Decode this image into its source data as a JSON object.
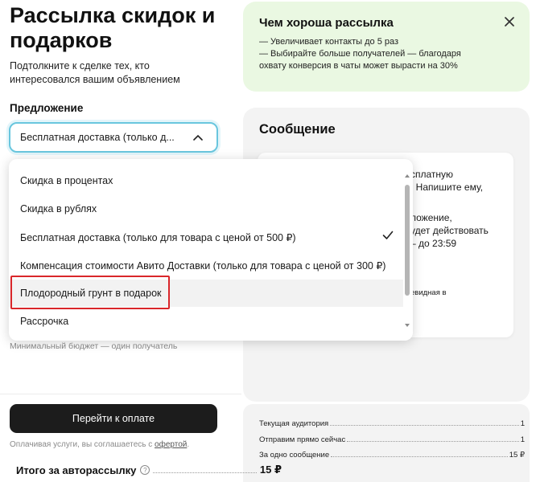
{
  "page": {
    "title": "Рассылка скидок и подарков",
    "subtitle": "Подтолкните к сделке тех, кто интересовался вашим объявлением"
  },
  "offer": {
    "label": "Предложение",
    "selected_value": "Бесплатная доставка (только д...",
    "options": [
      "Скидка в процентах",
      "Скидка в рублях",
      "Бесплатная доставка (только для товара с ценой от 500 ₽)",
      "Компенсация стоимости Авито Доставки (только для товара с ценой от 300 ₽)",
      "Плодородный грунт в подарок",
      "Рассрочка"
    ],
    "checked_index": 2,
    "hovered_index": 4
  },
  "budget_note": "Минимальный бюджет — один получатель",
  "payment": {
    "button_label": "Перейти к оплате",
    "agree_prefix": "Оплачивая услуги, вы соглашаетесь с ",
    "agree_link": "офертой",
    "agree_suffix": "."
  },
  "info_card": {
    "title": "Чем хороша рассылка",
    "line1": "— Увеличивает контакты до 5 раз",
    "line2": "— Выбирайте больше получателей — благодаря",
    "line3": "охвату конверсия в чаты может вырасти на 30%"
  },
  "message": {
    "title": "Сообщение",
    "line1": "сплатную",
    "line2": ". Напишите ему,",
    "line3": "ложение,",
    "line4": "удет действовать",
    "line5": "– до 23:59",
    "line6": "евидная в"
  },
  "summary": {
    "audience_label": "Текущая аудитория",
    "audience_value": "1",
    "send_now_label": "Отправим прямо сейчас",
    "send_now_value": "1",
    "per_message_label": "За одно сообщение",
    "per_message_value": "15 ₽",
    "total_label": "Итого за авторассылку",
    "total_value": "15 ₽"
  },
  "colors": {
    "select_border": "#69c6de",
    "highlight_border": "#d9262a",
    "info_card_bg": "#eaf8e2",
    "pay_button_bg": "#1c1c1c"
  }
}
